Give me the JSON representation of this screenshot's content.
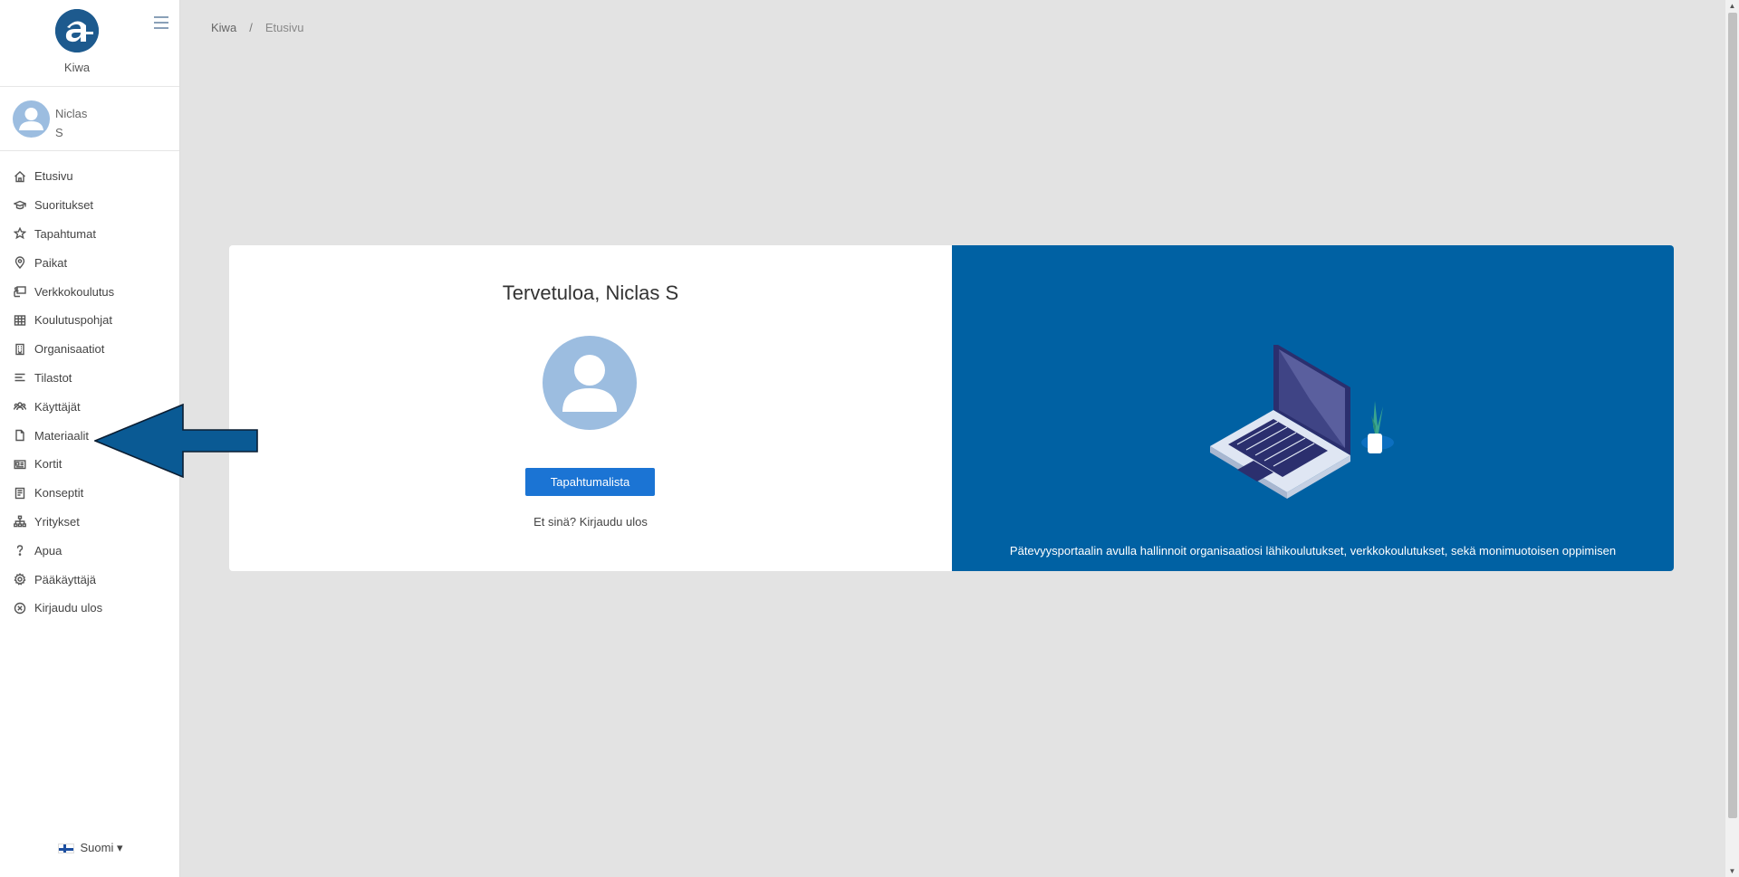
{
  "brand": {
    "name": "Kiwa",
    "logo_icon": "kiwa-logo-icon"
  },
  "user": {
    "first": "Niclas",
    "last": "S"
  },
  "nav": [
    {
      "label": "Etusivu",
      "icon": "home-icon"
    },
    {
      "label": "Suoritukset",
      "icon": "graduation-cap-icon"
    },
    {
      "label": "Tapahtumat",
      "icon": "star-icon"
    },
    {
      "label": "Paikat",
      "icon": "map-pin-icon"
    },
    {
      "label": "Verkkokoulutus",
      "icon": "online-training-icon"
    },
    {
      "label": "Koulutuspohjat",
      "icon": "table-icon"
    },
    {
      "label": "Organisaatiot",
      "icon": "building-icon"
    },
    {
      "label": "Tilastot",
      "icon": "lines-icon"
    },
    {
      "label": "Käyttäjät",
      "icon": "users-icon"
    },
    {
      "label": "Materiaalit",
      "icon": "document-icon"
    },
    {
      "label": "Kortit",
      "icon": "id-card-icon"
    },
    {
      "label": "Konseptit",
      "icon": "notebook-icon"
    },
    {
      "label": "Yritykset",
      "icon": "org-chart-icon"
    },
    {
      "label": "Apua",
      "icon": "question-icon"
    },
    {
      "label": "Pääkäyttäjä",
      "icon": "gear-icon"
    },
    {
      "label": "Kirjaudu ulos",
      "icon": "circle-x-icon"
    }
  ],
  "language": {
    "label": "Suomi ▾",
    "flag": "finland-flag-icon"
  },
  "breadcrumb": {
    "root": "Kiwa",
    "separator": "/",
    "current": "Etusivu"
  },
  "welcome": {
    "title": "Tervetuloa, Niclas S",
    "button": "Tapahtumalista",
    "not_you_prefix": "Et sinä?",
    "logout_link": "Kirjaudu ulos"
  },
  "promo": {
    "tagline": "Pätevyysportaalin avulla hallinnoit organisaatiosi lähikoulutukset, verkkokoulutukset, sekä monimuotoisen oppimisen"
  },
  "colors": {
    "brand_blue": "#0061a3",
    "button_blue": "#1b74d4",
    "avatar_blue": "#9cbde0",
    "background": "#e3e3e3"
  }
}
